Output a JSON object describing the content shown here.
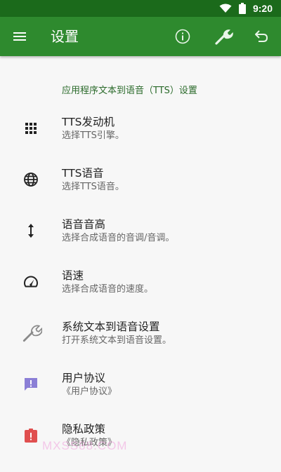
{
  "status_bar": {
    "time": "9:20"
  },
  "toolbar": {
    "title": "设置",
    "icons": [
      "menu-icon",
      "info-icon",
      "wrench-icon",
      "undo-icon"
    ]
  },
  "section_title": "应用程序文本到语音（TTS）设置",
  "items": [
    {
      "icon": "grid-icon",
      "title": "TTS发动机",
      "subtitle": "选择TTS引擎。"
    },
    {
      "icon": "globe-icon",
      "title": "TTS语音",
      "subtitle": "选择TTS语音。"
    },
    {
      "icon": "vertical-arrows-icon",
      "title": "语音音高",
      "subtitle": "选择合成语音的音调/音调。"
    },
    {
      "icon": "speedometer-icon",
      "title": "语速",
      "subtitle": "选择合成语音的速度。"
    },
    {
      "icon": "wrench-icon",
      "title": "系统文本到语音设置",
      "subtitle": "打开系统文本到语音设置。"
    },
    {
      "icon": "feedback-icon",
      "title": "用户协议",
      "subtitle": "《用户协议》"
    },
    {
      "icon": "alert-clipboard-icon",
      "title": "隐私政策",
      "subtitle": "《隐私政策》"
    }
  ],
  "watermark": "MXSS88.COM",
  "colors": {
    "status_bar": "#1b6a1b",
    "toolbar": "#2e8a2e",
    "section_title": "#2a6a2a",
    "feedback_icon": "#8b7fd6",
    "alert_icon": "#e04f4f"
  }
}
